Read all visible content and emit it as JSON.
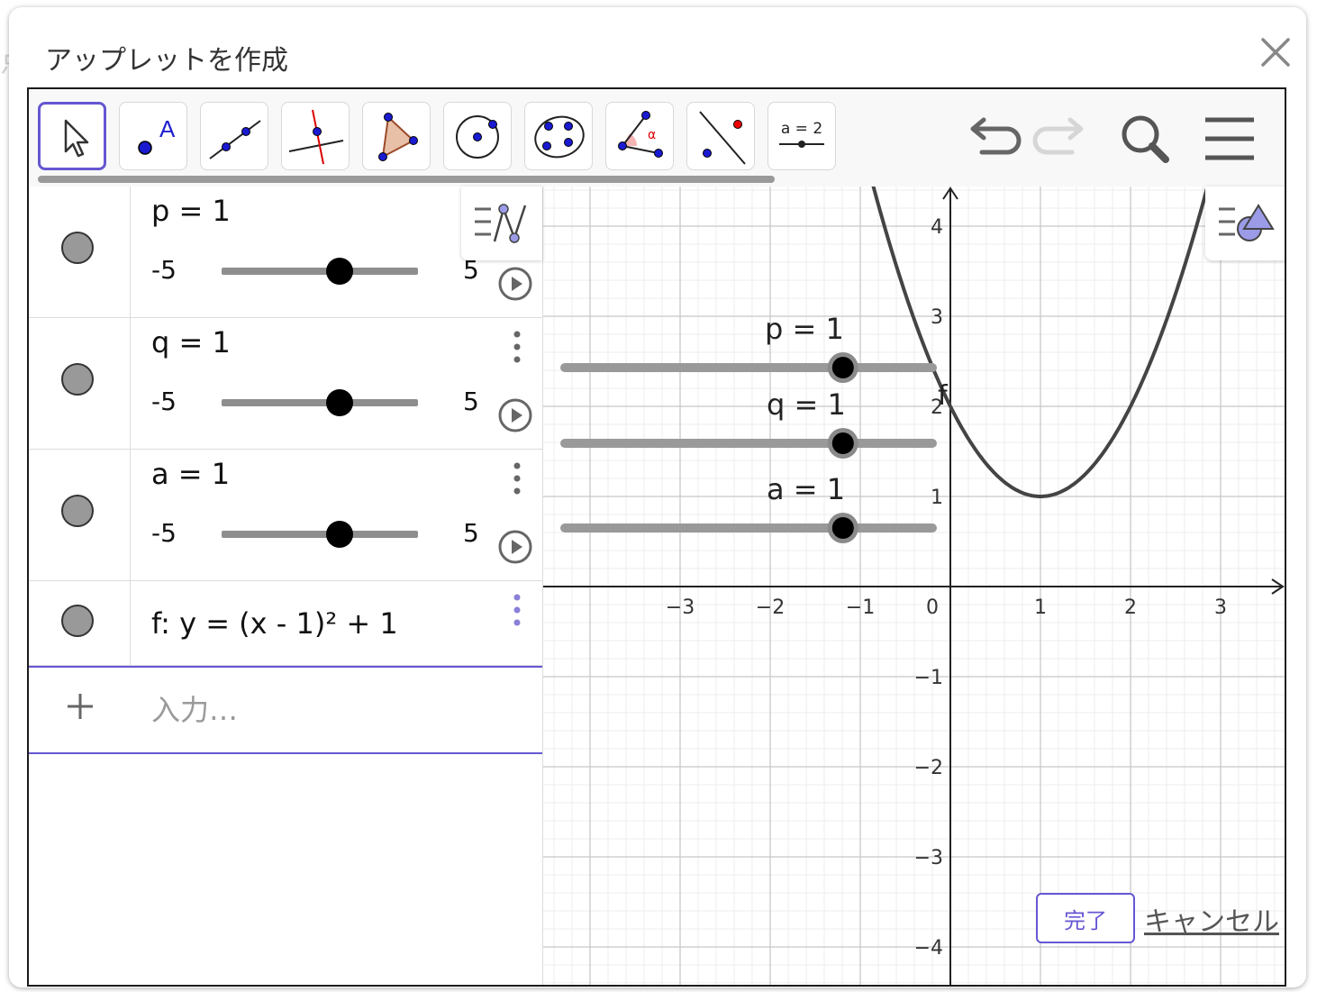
{
  "dialog": {
    "title": "アップレットを作成",
    "done_label": "完了",
    "cancel_label": "キャンセル"
  },
  "toolbar": {
    "tools": [
      {
        "name": "move-tool"
      },
      {
        "name": "point-tool",
        "label": "A"
      },
      {
        "name": "line-tool"
      },
      {
        "name": "perpendicular-line-tool"
      },
      {
        "name": "polygon-tool"
      },
      {
        "name": "circle-tool"
      },
      {
        "name": "conic-tool"
      },
      {
        "name": "angle-tool",
        "label": "α"
      },
      {
        "name": "reflect-tool"
      },
      {
        "name": "slider-tool",
        "label": "a = 2"
      }
    ],
    "undo": "undo-icon",
    "redo": "redo-icon",
    "search": "search-icon",
    "menu": "menu-icon"
  },
  "algebra": {
    "sliders": [
      {
        "def": "p = 1",
        "min": "-5",
        "max": "5",
        "value": 1,
        "range": [
          -5,
          5
        ]
      },
      {
        "def": "q = 1",
        "min": "-5",
        "max": "5",
        "value": 1,
        "range": [
          -5,
          5
        ]
      },
      {
        "def": "a = 1",
        "min": "-5",
        "max": "5",
        "value": 1,
        "range": [
          -5,
          5
        ]
      }
    ],
    "function_def": "f: y = (x - 1)² + 1",
    "input_placeholder": "入力…"
  },
  "graphics": {
    "function_label": "f",
    "x_ticks": [
      "-3",
      "-2",
      "-1",
      "0",
      "1",
      "2",
      "3"
    ],
    "y_ticks": [
      "4",
      "3",
      "2",
      "1",
      "-1",
      "-2",
      "-3",
      "-4"
    ],
    "sliders": [
      {
        "label": "p = 1",
        "value": 1
      },
      {
        "label": "q = 1",
        "value": 1
      },
      {
        "label": "a = 1",
        "value": 1
      }
    ]
  },
  "colors": {
    "accent": "#6557d2",
    "curve": "#444444",
    "grid_major": "#c8c8c8",
    "grid_minor": "#ececec"
  }
}
